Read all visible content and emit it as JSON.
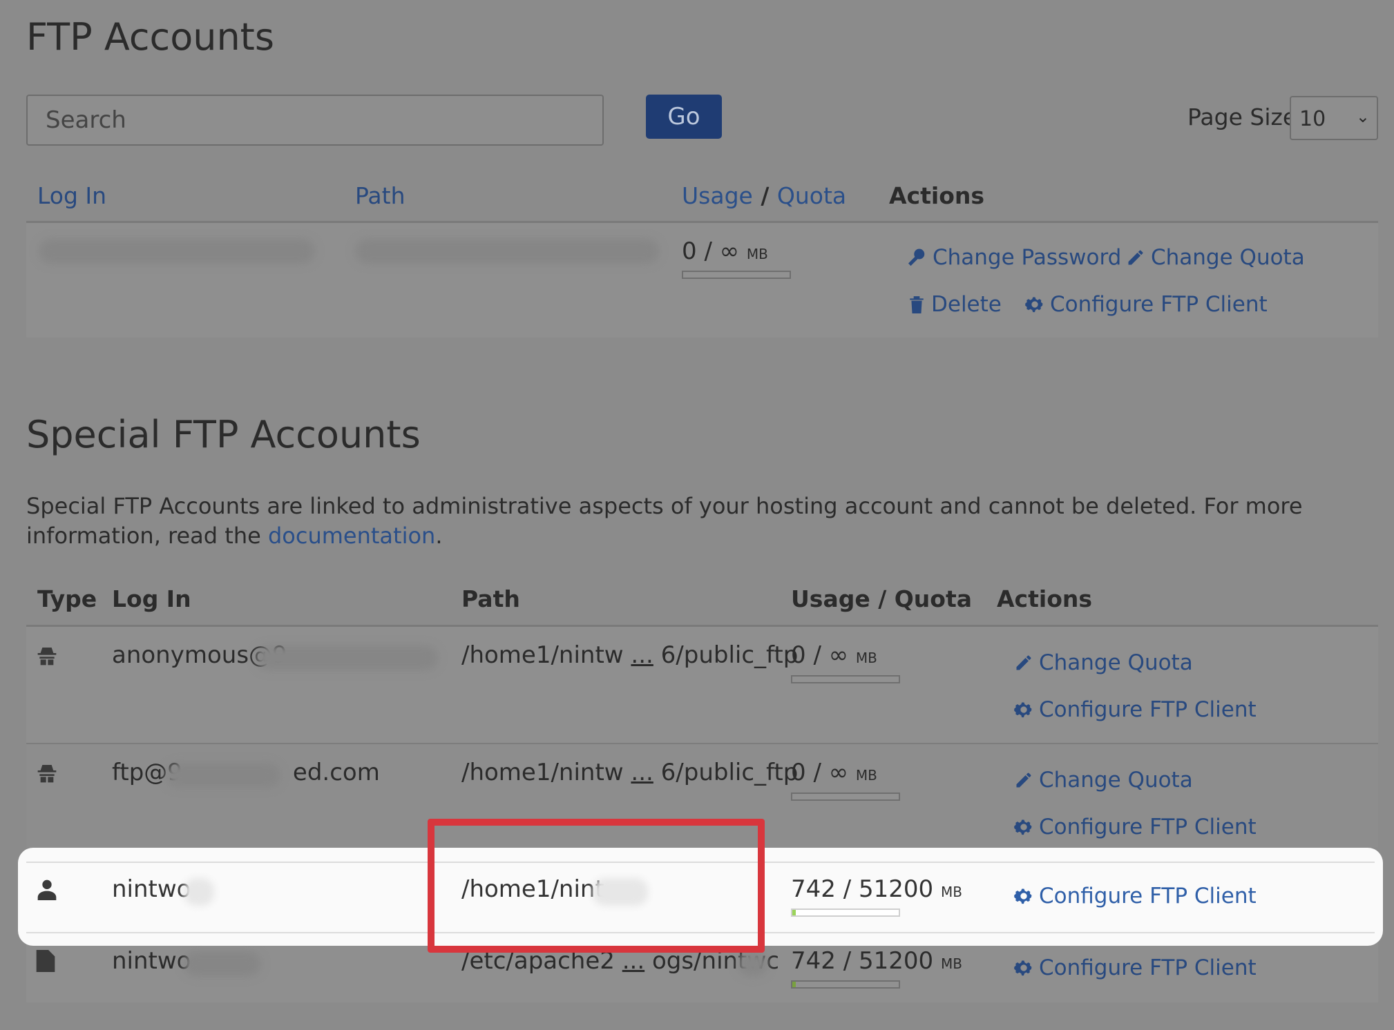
{
  "ftp_accounts": {
    "title": "FTP Accounts",
    "search_placeholder": "Search",
    "go_label": "Go",
    "page_size_label": "Page Size",
    "page_size_value": "10",
    "columns": {
      "login": "Log In",
      "path": "Path",
      "usage": "Usage",
      "slash": " / ",
      "quota": "Quota",
      "actions": "Actions"
    },
    "row": {
      "usage": "0 / ∞",
      "unit": "MB",
      "actions": [
        "Change Password",
        "Change Quota",
        "Delete",
        "Configure FTP Client"
      ]
    }
  },
  "special": {
    "title": "Special FTP Accounts",
    "description": "Special FTP Accounts are linked to administrative aspects of your hosting account and cannot be deleted. For more information, read the ",
    "doc_link": "documentation",
    "period": ".",
    "columns": {
      "type": "Type",
      "login": "Log In",
      "path": "Path",
      "usage": "Usage / Quota",
      "actions": "Actions"
    },
    "rows": [
      {
        "type_icon": "spy-icon",
        "login": "anonymous@9",
        "path_a": "/home1/nintw ",
        "path_ell": "...",
        "path_b": " 6/public_ftp",
        "usage": "0 / ∞",
        "unit": "MB",
        "fill": 0,
        "actions": [
          "Change Quota",
          "Configure FTP Client"
        ]
      },
      {
        "type_icon": "spy-icon",
        "login_a": "ftp@9",
        "login_b": "ed.com",
        "path_a": "/home1/nintw ",
        "path_ell": "...",
        "path_b": " 6/public_ftp",
        "usage": "0 / ∞",
        "unit": "MB",
        "fill": 0,
        "actions": [
          "Change Quota",
          "Configure FTP Client"
        ]
      },
      {
        "type_icon": "user-icon",
        "login": "nintwo",
        "path": "/home1/nint",
        "usage": "742 / 51200",
        "unit": "MB",
        "fill": 0.0145,
        "actions": [
          "Configure FTP Client"
        ]
      },
      {
        "type_icon": "file-icon",
        "login": "nintwo",
        "path_a": "/etc/apache2 ",
        "path_ell": "...",
        "path_b": " ogs/nintwc",
        "usage": "742 / 51200",
        "unit": "MB",
        "fill": 0.0145,
        "actions": [
          "Configure FTP Client"
        ]
      }
    ]
  }
}
